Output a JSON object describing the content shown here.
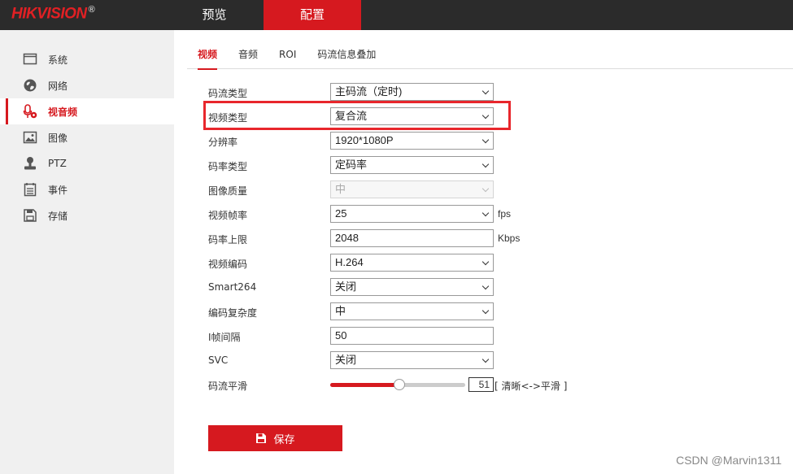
{
  "header": {
    "logo_text": "HIKVISION",
    "logo_mark": "®",
    "nav": [
      {
        "label": "预览"
      },
      {
        "label": "配置"
      }
    ]
  },
  "sidebar": {
    "items": [
      {
        "label": "系统",
        "icon": "monitor-icon"
      },
      {
        "label": "网络",
        "icon": "globe-icon"
      },
      {
        "label": "视音频",
        "icon": "microphone-icon"
      },
      {
        "label": "图像",
        "icon": "image-icon"
      },
      {
        "label": "PTZ",
        "icon": "ptz-icon"
      },
      {
        "label": "事件",
        "icon": "list-icon"
      },
      {
        "label": "存储",
        "icon": "floppy-icon"
      }
    ],
    "active_index": 2
  },
  "tabs": [
    {
      "label": "视频"
    },
    {
      "label": "音频"
    },
    {
      "label": "ROI"
    },
    {
      "label": "码流信息叠加"
    }
  ],
  "form": {
    "stream_type": {
      "label": "码流类型",
      "value": "主码流（定时)"
    },
    "video_type": {
      "label": "视频类型",
      "value": "复合流"
    },
    "resolution": {
      "label": "分辨率",
      "value": "1920*1080P"
    },
    "bitrate_type": {
      "label": "码率类型",
      "value": "定码率"
    },
    "image_quality": {
      "label": "图像质量",
      "value": "中"
    },
    "frame_rate": {
      "label": "视频帧率",
      "value": "25",
      "unit": "fps"
    },
    "max_bitrate": {
      "label": "码率上限",
      "value": "2048",
      "unit": "Kbps"
    },
    "video_encoding": {
      "label": "视频编码",
      "value": "H.264"
    },
    "smart264": {
      "label": "Smart264",
      "value": "关闭"
    },
    "encoding_complexity": {
      "label": "编码复杂度",
      "value": "中"
    },
    "i_frame_interval": {
      "label": "I帧间隔",
      "value": "50"
    },
    "svc": {
      "label": "SVC",
      "value": "关闭"
    },
    "stream_smoothing": {
      "label": "码流平滑",
      "value": "51",
      "value_fraction": 0.51,
      "hint": "[ 清晰<->平滑 ]"
    }
  },
  "save_button": {
    "label": "保存"
  },
  "watermark": "CSDN @Marvin1311",
  "colors": {
    "accent": "#d6191f",
    "topbar": "#2b2b2b",
    "sidebar": "#f0f0f0",
    "highlight": "#e8262c"
  }
}
